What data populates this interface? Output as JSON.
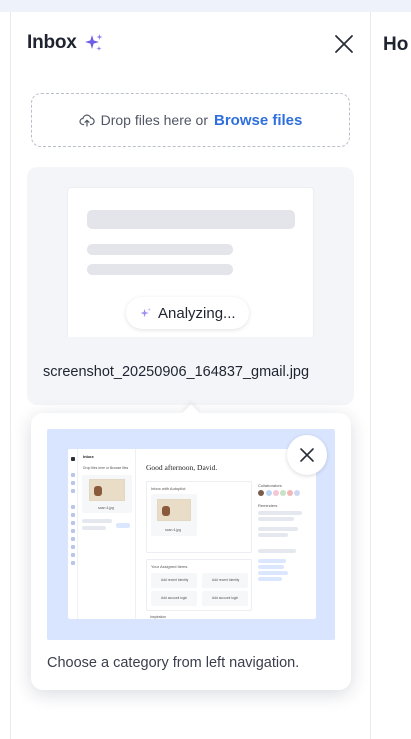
{
  "panel": {
    "title": "Inbox",
    "close_label": "Close"
  },
  "dropzone": {
    "text": "Drop files here or",
    "browse_label": "Browse files"
  },
  "file": {
    "status": "Analyzing...",
    "name": "screenshot_20250906_164837_gmail.jpg"
  },
  "tooltip": {
    "caption": "Choose a category from left navigation.",
    "preview": {
      "app_title": "Inbox",
      "greeting": "Good afternoon, David.",
      "drop_text": "Drop files here or Browse files",
      "inbox_file": "scan 4.jpg",
      "autopilot": "Inbox with Autopilot",
      "autopilot_file": "scan 4.jpg",
      "collaborators": "Collaborators",
      "reminders": "Reminders",
      "assigned": "Your Assigned Items",
      "inspiration": "Inspiration",
      "items": [
        "Add recent identity",
        "Add recent identity",
        "Add account login",
        "Add account login"
      ]
    }
  },
  "right_pane": {
    "title_partial": "Ho"
  },
  "colors": {
    "accent": "#2f6fde",
    "preview_bg": "#d9e5ff",
    "card_bg": "#f4f5f8"
  }
}
